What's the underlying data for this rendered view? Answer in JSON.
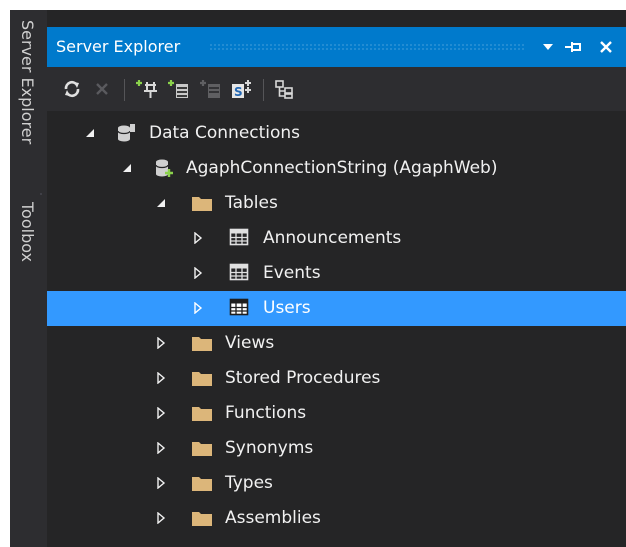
{
  "side_tabs": [
    "Server Explorer",
    "Toolbox"
  ],
  "panel": {
    "title": "Server Explorer",
    "colors": {
      "title_bar": "#007acc",
      "selection": "#3399ff",
      "folder": "#dcb67a",
      "background": "#252526"
    }
  },
  "toolbar": {
    "icons": [
      "refresh-icon",
      "stop-icon",
      "connect-to-database-icon",
      "connect-to-server-icon",
      "connect-to-sharepoint-icon",
      "connect-to-azure-icon",
      "properties-icon"
    ]
  },
  "tree": {
    "data_connections": "Data Connections",
    "connection": "AgaphConnectionString (AgaphWeb)",
    "tables": "Tables",
    "table_items": [
      "Announcements",
      "Events",
      "Users"
    ],
    "folders": [
      "Views",
      "Stored Procedures",
      "Functions",
      "Synonyms",
      "Types",
      "Assemblies"
    ]
  }
}
